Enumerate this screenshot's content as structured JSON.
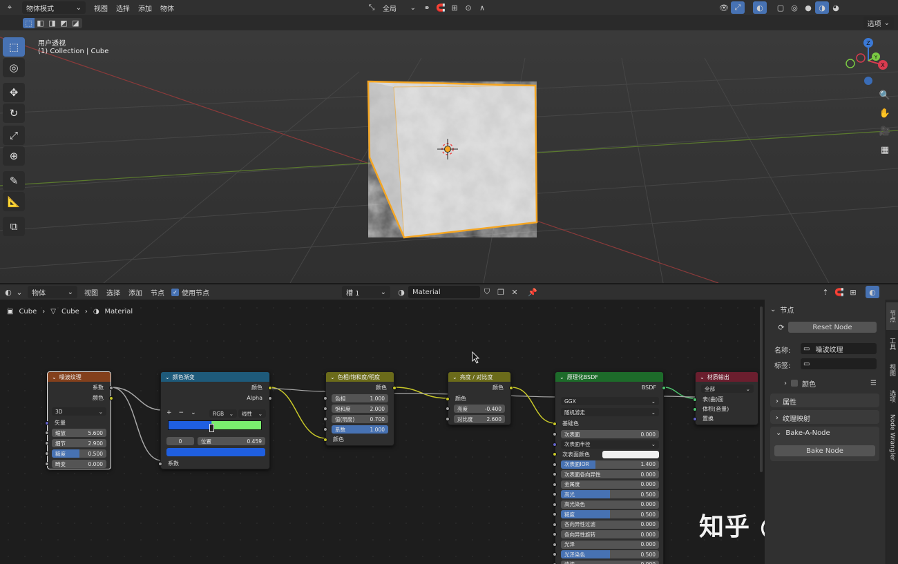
{
  "top_header": {
    "mode": "物体模式",
    "menus": [
      "视图",
      "选择",
      "添加",
      "物体"
    ],
    "transform_orientation": "全局",
    "overlay_button": "选项"
  },
  "viewport": {
    "view_name": "用户透视",
    "collection_info": "(1) Collection | Cube",
    "gizmo_axes": [
      "Z",
      "Y",
      "X"
    ]
  },
  "node_header": {
    "editor_type": "物体",
    "menus": [
      "视图",
      "选择",
      "添加",
      "节点"
    ],
    "use_nodes_label": "使用节点",
    "slot": "槽 1",
    "material_name": "Material"
  },
  "breadcrumb": [
    "Cube",
    "Cube",
    "Material"
  ],
  "nodes": {
    "noise": {
      "title": "噪波纹理",
      "outputs": [
        "系数",
        "颜色"
      ],
      "dimension": "3D",
      "vector_label": "矢量",
      "fields": [
        {
          "label": "缩放",
          "value": "5.600"
        },
        {
          "label": "细节",
          "value": "2.900"
        },
        {
          "label": "糙度",
          "value": "0.500",
          "fill": 0.5
        },
        {
          "label": "畸变",
          "value": "0.000"
        }
      ]
    },
    "ramp": {
      "title": "颜色渐变",
      "outputs": [
        "颜色",
        "Alpha"
      ],
      "controls": [
        "+",
        "−",
        "⌄"
      ],
      "color_mode": "RGB",
      "interpolation": "线性",
      "stop_index": "0",
      "position_label": "位置",
      "position_value": "0.459",
      "input_label": "系数",
      "ramp_colors": [
        "#1f5fe0",
        "#7aee6e"
      ],
      "active_color": "#1f5fe0"
    },
    "hsv": {
      "title": "色相/饱和度/明度",
      "output": "颜色",
      "fields": [
        {
          "label": "色相",
          "value": "1.000"
        },
        {
          "label": "饱和度",
          "value": "2.000"
        },
        {
          "label": "值(明度)",
          "value": "0.700"
        },
        {
          "label": "系数",
          "value": "1.000",
          "fill": 1.0
        }
      ],
      "color_input": "颜色"
    },
    "bc": {
      "title": "亮度 / 对比度",
      "output": "颜色",
      "color_input": "颜色",
      "fields": [
        {
          "label": "亮度",
          "value": "-0.400"
        },
        {
          "label": "对比度",
          "value": "2.600"
        }
      ]
    },
    "bsdf": {
      "title": "原理化BSDF",
      "output": "BSDF",
      "distribution": "GGX",
      "sss_method": "随机游走",
      "base_color": "基础色",
      "rows": [
        {
          "label": "次表面",
          "value": "0.000"
        },
        {
          "label": "次表面半径",
          "value": "",
          "dropdown": true
        },
        {
          "label": "次表面颜色",
          "value": "",
          "swatch": "#f0f0f0"
        },
        {
          "label": "次表面IOR",
          "value": "1.400",
          "fill": 0.35
        },
        {
          "label": "次表面各向异性",
          "value": "0.000"
        },
        {
          "label": "金属度",
          "value": "0.000"
        },
        {
          "label": "高光",
          "value": "0.500",
          "fill": 0.5
        },
        {
          "label": "高光染色",
          "value": "0.000"
        },
        {
          "label": "糙度",
          "value": "0.500",
          "fill": 0.5
        },
        {
          "label": "各向异性过滤",
          "value": "0.000"
        },
        {
          "label": "各向异性旋转",
          "value": "0.000"
        },
        {
          "label": "光泽",
          "value": "0.000"
        },
        {
          "label": "光泽染色",
          "value": "0.500",
          "fill": 0.5
        },
        {
          "label": "清漆",
          "value": "0.000"
        }
      ]
    },
    "output": {
      "title": "材质输出",
      "target": "全部",
      "inputs": [
        "表(曲)面",
        "体积(音量)",
        "置换"
      ]
    }
  },
  "sidebar": {
    "node_panel_title": "节点",
    "reset_label": "Reset Node",
    "name_label": "名称:",
    "name_value": "噪波纹理",
    "label_label": "标签:",
    "label_value": "",
    "color_label": "颜色",
    "properties_label": "属性",
    "texture_mapping_label": "纹理映射",
    "bake_panel_title": "Bake-A-Node",
    "bake_button": "Bake Node",
    "tabs": [
      "节点",
      "工具",
      "视图",
      "选项",
      "Node Wrangler"
    ]
  },
  "watermark": "知乎 @mango",
  "colors": {
    "accent": "#4772b3",
    "selection": "#f5a623",
    "noise_header": "#83401c",
    "ramp_header": "#1e5a7a",
    "hsv_header": "#6b6b1a",
    "bsdf_header": "#1d6b2a",
    "output_header": "#6b1e2e"
  }
}
